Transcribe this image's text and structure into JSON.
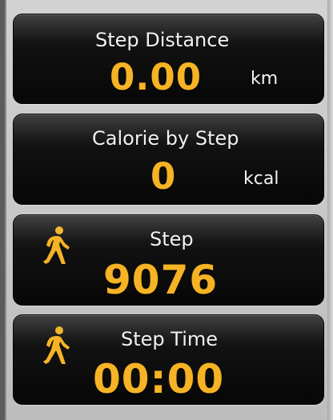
{
  "colors": {
    "tile_background": "#0b0b0b",
    "label_text": "#f2f2f2",
    "value_text": "#f5b325",
    "panel_background": "#c8c8c8"
  },
  "tiles": [
    {
      "label": "Step Distance",
      "value": "0.00",
      "unit": "km"
    },
    {
      "label": "Calorie by Step",
      "value": "0",
      "unit": "kcal"
    },
    {
      "label": "Step",
      "value": "9076",
      "icon": "walking-person-icon"
    },
    {
      "label": "Step Time",
      "value": "00:00",
      "icon": "walking-person-icon"
    }
  ]
}
